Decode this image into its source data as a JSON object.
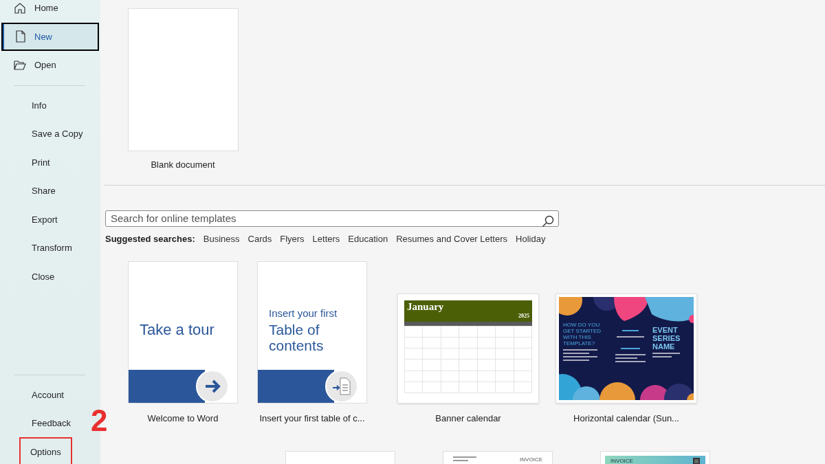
{
  "sidebar": {
    "top": [
      {
        "label": "Home",
        "selected": false
      },
      {
        "label": "New",
        "selected": true
      },
      {
        "label": "Open",
        "selected": false
      }
    ],
    "middle": [
      {
        "label": "Info"
      },
      {
        "label": "Save a Copy"
      },
      {
        "label": "Print"
      },
      {
        "label": "Share"
      },
      {
        "label": "Export"
      },
      {
        "label": "Transform"
      },
      {
        "label": "Close"
      }
    ],
    "bottom": [
      {
        "label": "Account",
        "highlighted": false
      },
      {
        "label": "Feedback",
        "highlighted": false
      },
      {
        "label": "Options",
        "highlighted": true
      }
    ]
  },
  "annotation": {
    "label": "2"
  },
  "blank": {
    "label": "Blank document"
  },
  "search": {
    "placeholder": "Search for online templates"
  },
  "suggested": {
    "label": "Suggested searches:",
    "items": [
      "Business",
      "Cards",
      "Flyers",
      "Letters",
      "Education",
      "Resumes and Cover Letters",
      "Holiday"
    ]
  },
  "templates": [
    {
      "kind": "tour",
      "label": "Welcome to Word",
      "texts": [
        "Take a tour"
      ]
    },
    {
      "kind": "toc",
      "label": "Insert your first table of c...",
      "texts": [
        "Insert your first",
        "Table of contents"
      ]
    },
    {
      "kind": "calendar",
      "label": "Banner calendar",
      "texts": [
        "January",
        "2025"
      ]
    },
    {
      "kind": "event",
      "label": "Horizontal calendar (Sun...",
      "texts": [
        "HOW DO YOU GET STARTED WITH THIS TEMPLATE?",
        "EVENT SERIES NAME"
      ]
    }
  ],
  "more_templates": [
    {
      "kind": "invoice_plain"
    },
    {
      "kind": "invoice_company",
      "texts": [
        "INVOICE"
      ]
    },
    {
      "kind": "invoice_teal",
      "texts": [
        "INVOICE"
      ]
    }
  ]
}
